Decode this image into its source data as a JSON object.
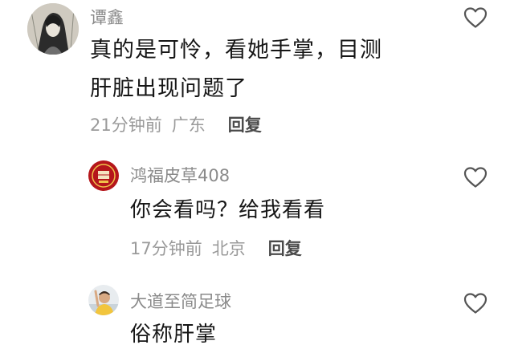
{
  "comments": [
    {
      "author": "谭鑫",
      "lines": [
        "真的是可怜，看她手掌，目测",
        "肝脏出现问题了"
      ],
      "time": "21分钟前",
      "location": "广东",
      "reply_label": "回复",
      "avatar_icon": "sketch-portrait-avatar",
      "like_icon": "heart-outline-icon"
    },
    {
      "author": "鸿福皮草408",
      "lines": [
        "你会看吗？给我看看"
      ],
      "time": "17分钟前",
      "location": "北京",
      "reply_label": "回复",
      "avatar_icon": "red-seal-avatar",
      "like_icon": "heart-outline-icon"
    },
    {
      "author": "大道至简足球",
      "lines": [
        "俗称肝掌"
      ],
      "avatar_icon": "person-photo-avatar",
      "like_icon": "heart-outline-icon"
    }
  ],
  "colors": {
    "author": "#8a8a8a",
    "text": "#161616",
    "meta": "#9a9a9a",
    "reply": "#4a4a4a",
    "icon": "#555555"
  }
}
